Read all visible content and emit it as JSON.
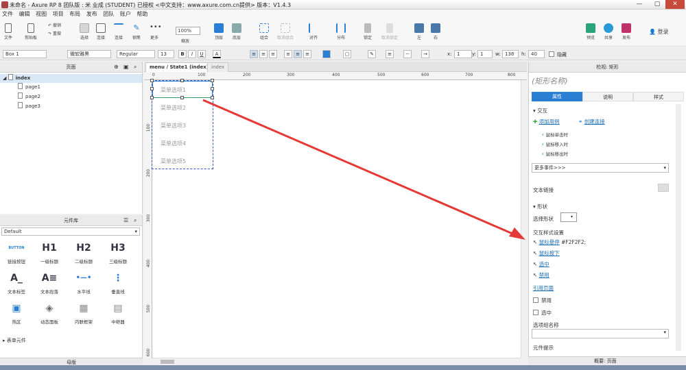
{
  "title_bar": {
    "text": "未命名 - Axure RP 8 团队版 : 米 业成 (STUDENT) 已授权 <中文支持：www.axure.com.cn提供> 版本：V1.4.3",
    "minimize": "—",
    "maximize": "▢",
    "close": "✕"
  },
  "menu": [
    "文件",
    "编辑",
    "视图",
    "项目",
    "布局",
    "发布",
    "团队",
    "账户",
    "帮助"
  ],
  "toolbar": {
    "file": "文件",
    "clipboard": "剪贴板",
    "undo": "撤销",
    "redo": "重做",
    "select": "选择",
    "connect": "连接",
    "pen": "钢笔",
    "more": "更多",
    "zoom_value": "100%",
    "zoom_label": "缩放",
    "top": "顶层",
    "bottom": "底层",
    "group": "组合",
    "ungroup": "取消组合",
    "align": "对齐",
    "distribute": "分布",
    "lock": "锁定",
    "unlock": "取消锁定",
    "left": "左",
    "right": "右",
    "preview": "预览",
    "share": "共享",
    "publish": "发布",
    "login": "登录"
  },
  "format": {
    "element_name": "Box 1",
    "font_family": "微软雅黑",
    "font_style": "Regular",
    "font_size": "13",
    "bold": "B",
    "italic": "I",
    "underline": "U",
    "x_label": "x:",
    "x_value": "1",
    "y_label": "y:",
    "y_value": "1",
    "w_label": "w:",
    "w_value": "138",
    "h_label": "h:",
    "h_value": "40",
    "hidden_label": "隐藏"
  },
  "pages_panel": {
    "title": "页面",
    "items": [
      {
        "label": "index",
        "level": 0
      },
      {
        "label": "page1",
        "level": 1
      },
      {
        "label": "page2",
        "level": 1
      },
      {
        "label": "page3",
        "level": 1
      }
    ]
  },
  "library_panel": {
    "title": "元件库",
    "library_name": "Default",
    "widgets": [
      {
        "icon": "BUTTON",
        "label": "链接按钮"
      },
      {
        "icon": "H1",
        "label": "一级标题"
      },
      {
        "icon": "H2",
        "label": "二级标题"
      },
      {
        "icon": "H3",
        "label": "三级标题"
      },
      {
        "icon": "A_",
        "label": "文本标签"
      },
      {
        "icon": "A≡",
        "label": "文本段落"
      },
      {
        "icon": "•—•",
        "label": "水平线"
      },
      {
        "icon": "⋮",
        "label": "垂直线"
      },
      {
        "icon": "▣",
        "label": "热区"
      },
      {
        "icon": "◈",
        "label": "动态面板"
      },
      {
        "icon": "▦",
        "label": "内联框架"
      },
      {
        "icon": "▤",
        "label": "中继器"
      }
    ],
    "section": "表单元件"
  },
  "masters_panel": {
    "title": "母版"
  },
  "canvas": {
    "tabs": [
      "menu / State1 (index)",
      "index"
    ],
    "ruler_top": [
      "0",
      "100",
      "200",
      "300",
      "400",
      "500",
      "600",
      "700",
      "800"
    ],
    "ruler_left": [
      "100",
      "200",
      "300",
      "400",
      "500",
      "600"
    ],
    "menu_options": [
      "菜单选项1",
      "菜单选项2",
      "菜单选项3",
      "菜单选项4",
      "菜单选项5"
    ]
  },
  "inspector": {
    "header": "检视: 矩形",
    "shape_name_placeholder": "(矩形名称)",
    "tabs": [
      "属性",
      "说明",
      "样式"
    ],
    "interaction_title": "交互",
    "add_case": "添加用例",
    "create_link": "创建连接",
    "events": [
      "鼠标单击时",
      "鼠标移入时",
      "鼠标移出时"
    ],
    "more_events": "更多事件>>>",
    "text_link": "文本链接",
    "shape_title": "形状",
    "select_shape": "选择形状",
    "interaction_styles_title": "交互样式设置",
    "interaction_styles": [
      "鼠标悬停",
      "鼠标按下",
      "选中",
      "禁用"
    ],
    "hover_value": "#F2F2F2;",
    "reference_page": "引用页面",
    "checkboxes": [
      "禁用",
      "选中"
    ],
    "group_label": "选项组名称",
    "tooltip_label": "元件提示"
  },
  "status": {
    "overview": "概要: 页面"
  },
  "colors": {
    "accent": "#2a7fd4",
    "arrow": "#e53935",
    "selection": "#3355cc"
  }
}
